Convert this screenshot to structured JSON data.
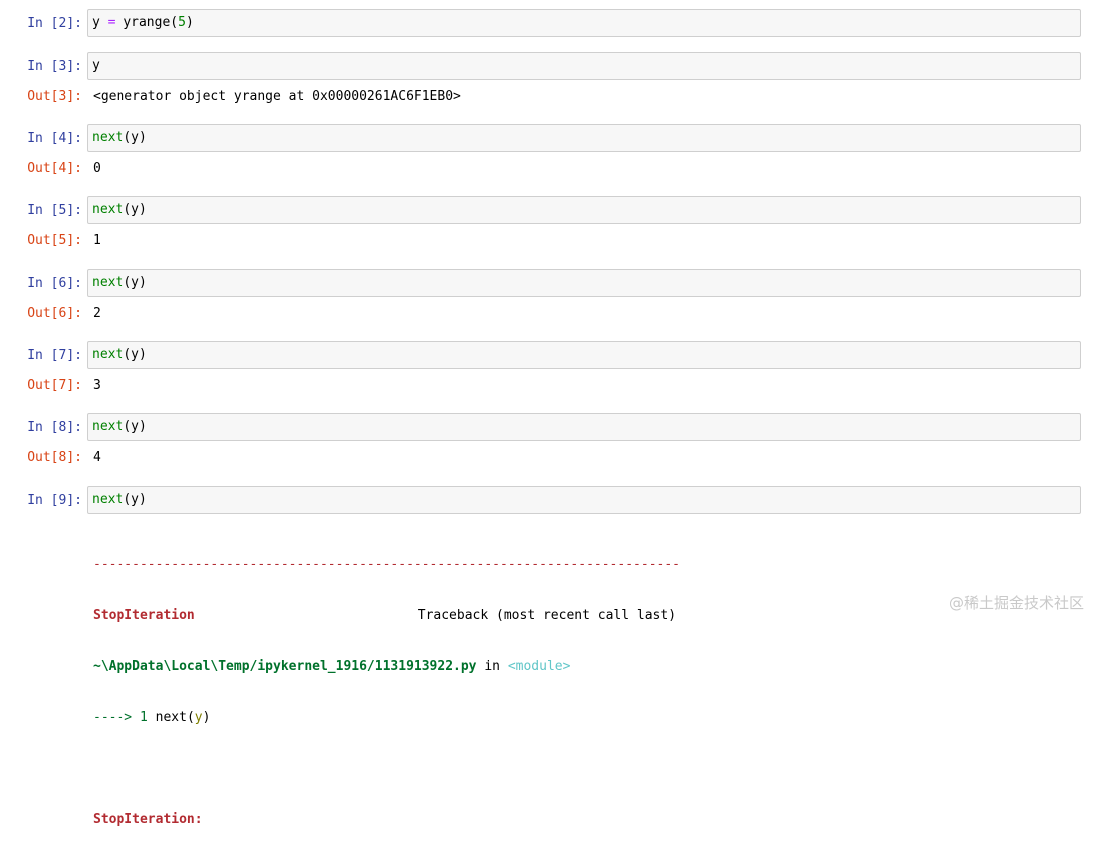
{
  "cells": [
    {
      "in_prompt": "In [2]:",
      "code_parts": [
        "y",
        " = ",
        "yrange",
        "(",
        "5",
        ")"
      ]
    },
    {
      "in_prompt": "In [3]:",
      "code": "y",
      "out_prompt": "Out[3]:",
      "output": "<generator object yrange at 0x00000261AC6F1EB0>"
    },
    {
      "in_prompt": "In [4]:",
      "code_fn": "next",
      "code_rest": "(y)",
      "out_prompt": "Out[4]:",
      "output": "0"
    },
    {
      "in_prompt": "In [5]:",
      "code_fn": "next",
      "code_rest": "(y)",
      "out_prompt": "Out[5]:",
      "output": "1"
    },
    {
      "in_prompt": "In [6]:",
      "code_fn": "next",
      "code_rest": "(y)",
      "out_prompt": "Out[6]:",
      "output": "2"
    },
    {
      "in_prompt": "In [7]:",
      "code_fn": "next",
      "code_rest": "(y)",
      "out_prompt": "Out[7]:",
      "output": "3"
    },
    {
      "in_prompt": "In [8]:",
      "code_fn": "next",
      "code_rest": "(y)",
      "out_prompt": "Out[8]:",
      "output": "4"
    },
    {
      "in_prompt": "In [9]:",
      "code_fn": "next",
      "code_rest": "(y)"
    }
  ],
  "traceback": {
    "separator": "---------------------------------------------------------------------------",
    "error_name": "StopIteration",
    "header_right": "Traceback (most recent call last)",
    "file_path": "~\\AppData\\Local\\Temp/ipykernel_1916/1131913922.py",
    "in_word": " in ",
    "module": "<module>",
    "arrow": "----> 1 ",
    "arrow_fn": "next",
    "arrow_open": "(",
    "arrow_arg": "y",
    "arrow_close": ")",
    "final_error": "StopIteration:"
  },
  "watermark": "@稀土掘金技术社区"
}
